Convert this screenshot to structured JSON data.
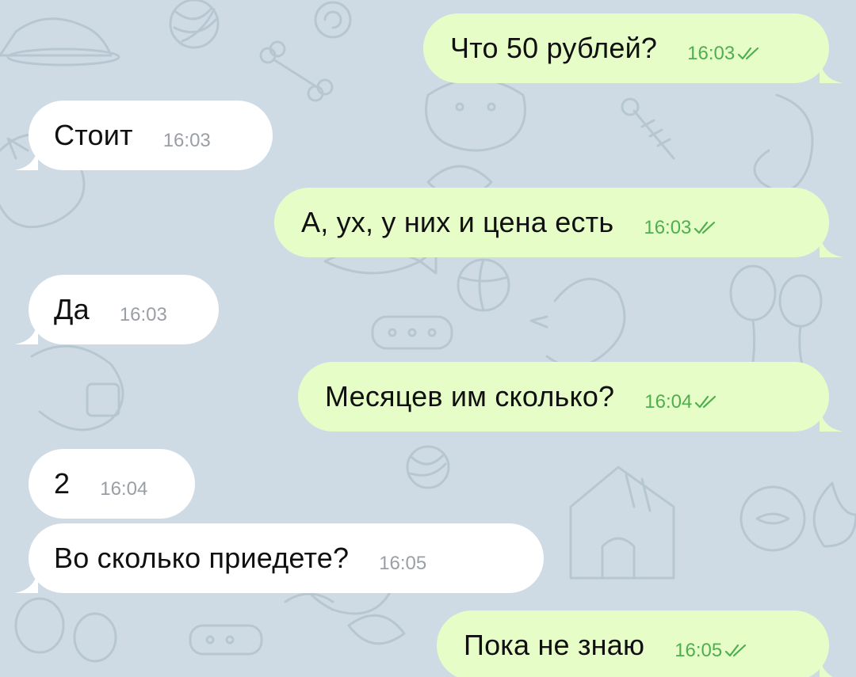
{
  "colors": {
    "background": "#cfdbe4",
    "outgoing_bubble": "#e6fdc8",
    "incoming_bubble": "#ffffff",
    "outgoing_time": "#4fae4e",
    "incoming_time": "#9a9fa5",
    "doodle_stroke": "#b7c7d2"
  },
  "messages": [
    {
      "direction": "outgoing",
      "text": "Что 50 рублей?",
      "time": "16:03",
      "status_icon": "double-check-icon"
    },
    {
      "direction": "incoming",
      "text": "Стоит",
      "time": "16:03"
    },
    {
      "direction": "outgoing",
      "text": "А, ух, у них и цена есть",
      "time": "16:03",
      "status_icon": "double-check-icon"
    },
    {
      "direction": "incoming",
      "text": "Да",
      "time": "16:03"
    },
    {
      "direction": "outgoing",
      "text": "Месяцев им сколько?",
      "time": "16:04",
      "status_icon": "double-check-icon"
    },
    {
      "direction": "incoming",
      "text": "2",
      "time": "16:04"
    },
    {
      "direction": "incoming",
      "text": "Во сколько приедете?",
      "time": "16:05"
    },
    {
      "direction": "outgoing",
      "text": "Пока не знаю",
      "time": "16:05",
      "status_icon": "double-check-icon"
    }
  ]
}
